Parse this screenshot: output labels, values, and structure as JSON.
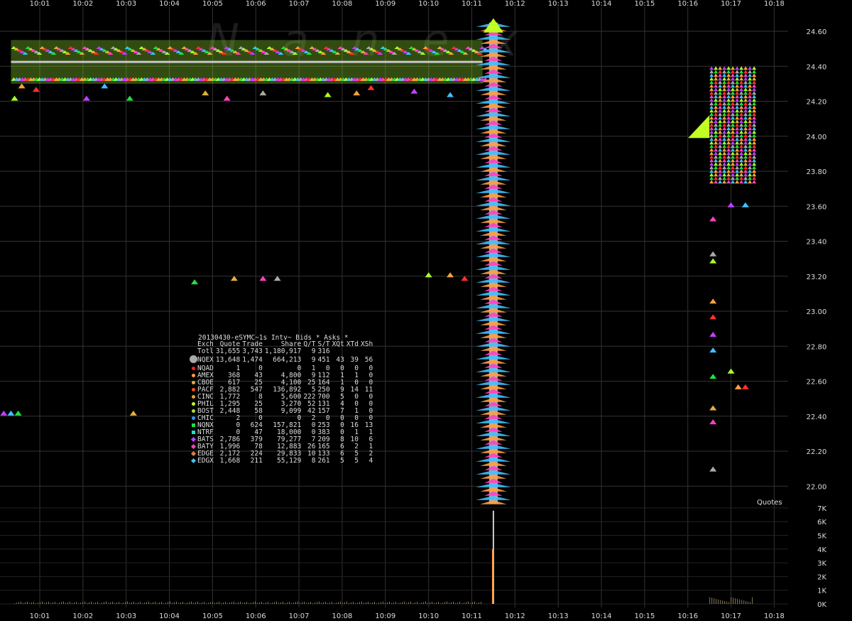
{
  "watermark": "Nanex",
  "legend": {
    "title": "20130430-eSYMC~1s Intv~ Bids * Asks *",
    "columns": [
      "Exch",
      "Quote",
      "Trade",
      "Share",
      "Q/T",
      "S/T",
      "XQt",
      "XTd",
      "XSh"
    ],
    "rows": [
      {
        "exch": "Totl",
        "quote": "31,655",
        "trade": "3,743",
        "share": "1,180,917",
        "qt": "9",
        "st": "316",
        "xqt": "",
        "xtd": "",
        "xsh": "",
        "color": "",
        "shape": "none"
      },
      {
        "exch": "NQEX",
        "quote": "13,648",
        "trade": "1,474",
        "share": "664,213",
        "qt": "9",
        "st": "451",
        "xqt": "43",
        "xtd": "39",
        "xsh": "56",
        "color": "#aaaaaa",
        "shape": "big"
      },
      {
        "exch": "NQAD",
        "quote": "1",
        "trade": "0",
        "share": "0",
        "qt": "1",
        "st": "0",
        "xqt": "0",
        "xtd": "0",
        "xsh": "0",
        "color": "#ff2020",
        "shape": "dot"
      },
      {
        "exch": "AMEX",
        "quote": "368",
        "trade": "43",
        "share": "4,800",
        "qt": "9",
        "st": "112",
        "xqt": "1",
        "xtd": "1",
        "xsh": "0",
        "color": "#ff9f40",
        "shape": "dot"
      },
      {
        "exch": "CBOE",
        "quote": "617",
        "trade": "25",
        "share": "4,100",
        "qt": "25",
        "st": "164",
        "xqt": "1",
        "xtd": "0",
        "xsh": "0",
        "color": "#e0b040",
        "shape": "dot"
      },
      {
        "exch": "PACF",
        "quote": "2,882",
        "trade": "547",
        "share": "136,892",
        "qt": "5",
        "st": "250",
        "xqt": "9",
        "xtd": "14",
        "xsh": "11",
        "color": "#ff5010",
        "shape": "dot"
      },
      {
        "exch": "CINC",
        "quote": "1,772",
        "trade": "8",
        "share": "5,600",
        "qt": "222",
        "st": "700",
        "xqt": "5",
        "xtd": "0",
        "xsh": "0",
        "color": "#f0a020",
        "shape": "dot"
      },
      {
        "exch": "PHIL",
        "quote": "1,295",
        "trade": "25",
        "share": "3,270",
        "qt": "52",
        "st": "131",
        "xqt": "4",
        "xtd": "0",
        "xsh": "0",
        "color": "#c0ff20",
        "shape": "dot"
      },
      {
        "exch": "BOST",
        "quote": "2,448",
        "trade": "58",
        "share": "9,099",
        "qt": "42",
        "st": "157",
        "xqt": "7",
        "xtd": "1",
        "xsh": "0",
        "color": "#a8e040",
        "shape": "dot"
      },
      {
        "exch": "CHIC",
        "quote": "2",
        "trade": "0",
        "share": "0",
        "qt": "2",
        "st": "0",
        "xqt": "0",
        "xtd": "0",
        "xsh": "0",
        "color": "#4090ff",
        "shape": "dot"
      },
      {
        "exch": "NQNX",
        "quote": "0",
        "trade": "624",
        "share": "157,821",
        "qt": "0",
        "st": "253",
        "xqt": "0",
        "xtd": "16",
        "xsh": "13",
        "color": "#20e040",
        "shape": "sq"
      },
      {
        "exch": "NTRF",
        "quote": "0",
        "trade": "47",
        "share": "18,000",
        "qt": "0",
        "st": "383",
        "xqt": "0",
        "xtd": "1",
        "xsh": "1",
        "color": "#20e0c0",
        "shape": "sq"
      },
      {
        "exch": "BATS",
        "quote": "2,786",
        "trade": "379",
        "share": "79,277",
        "qt": "7",
        "st": "209",
        "xqt": "8",
        "xtd": "10",
        "xsh": "6",
        "color": "#c040ff",
        "shape": "dia"
      },
      {
        "exch": "BATY",
        "quote": "1,996",
        "trade": "78",
        "share": "12,883",
        "qt": "26",
        "st": "165",
        "xqt": "6",
        "xtd": "2",
        "xsh": "1",
        "color": "#ff40c0",
        "shape": "dia"
      },
      {
        "exch": "EDGE",
        "quote": "2,172",
        "trade": "224",
        "share": "29,833",
        "qt": "10",
        "st": "133",
        "xqt": "6",
        "xtd": "5",
        "xsh": "2",
        "color": "#e08040",
        "shape": "dia"
      },
      {
        "exch": "EDGX",
        "quote": "1,668",
        "trade": "211",
        "share": "55,129",
        "qt": "8",
        "st": "261",
        "xqt": "5",
        "xtd": "5",
        "xsh": "4",
        "color": "#40c0ff",
        "shape": "dia"
      }
    ]
  },
  "chart_data": [
    {
      "type": "scatter",
      "name_hint": "quotes",
      "x_ticks": [
        "10:01",
        "10:02",
        "10:03",
        "10:04",
        "10:05",
        "10:06",
        "10:07",
        "10:08",
        "10:09",
        "10:10",
        "10:11",
        "10:12",
        "10:13",
        "10:14",
        "10:15",
        "10:16",
        "10:17",
        "10:18"
      ],
      "y_ticks": [
        "24.60",
        "24.40",
        "24.20",
        "24.00",
        "23.80",
        "23.60",
        "23.40",
        "23.20",
        "23.00",
        "22.80",
        "22.60",
        "22.40",
        "22.20",
        "22.00"
      ],
      "ylim": [
        21.95,
        24.65
      ],
      "grid": true,
      "band": {
        "from": "10:00:20",
        "to": "10:11:15",
        "low": 24.3,
        "high": 24.55
      },
      "spike": {
        "time": "10:11:30",
        "low": 21.9,
        "high": 24.65
      },
      "after_halt_cluster": {
        "from": "10:16:30",
        "to": "10:17:30",
        "low": 23.75,
        "high": 24.4
      },
      "scattered_points": [
        {
          "t": "10:00:25",
          "p": 24.22
        },
        {
          "t": "10:00:35",
          "p": 24.29
        },
        {
          "t": "10:00:55",
          "p": 24.27
        },
        {
          "t": "10:02:05",
          "p": 24.22
        },
        {
          "t": "10:02:30",
          "p": 24.29
        },
        {
          "t": "10:03:05",
          "p": 24.22
        },
        {
          "t": "10:04:50",
          "p": 24.25
        },
        {
          "t": "10:05:20",
          "p": 24.22
        },
        {
          "t": "10:06:10",
          "p": 24.25
        },
        {
          "t": "10:07:40",
          "p": 24.24
        },
        {
          "t": "10:08:20",
          "p": 24.25
        },
        {
          "t": "10:08:40",
          "p": 24.28
        },
        {
          "t": "10:09:40",
          "p": 24.26
        },
        {
          "t": "10:10:30",
          "p": 24.24
        },
        {
          "t": "10:04:35",
          "p": 23.17
        },
        {
          "t": "10:05:30",
          "p": 23.19
        },
        {
          "t": "10:06:10",
          "p": 23.19
        },
        {
          "t": "10:06:30",
          "p": 23.19
        },
        {
          "t": "10:10:00",
          "p": 23.21
        },
        {
          "t": "10:10:30",
          "p": 23.21
        },
        {
          "t": "10:10:50",
          "p": 23.19
        },
        {
          "t": "10:00:10",
          "p": 22.42
        },
        {
          "t": "10:00:20",
          "p": 22.42
        },
        {
          "t": "10:00:30",
          "p": 22.42
        },
        {
          "t": "10:03:10",
          "p": 22.42
        },
        {
          "t": "10:16:35",
          "p": 23.53
        },
        {
          "t": "10:16:35",
          "p": 23.33
        },
        {
          "t": "10:16:35",
          "p": 23.29
        },
        {
          "t": "10:16:35",
          "p": 23.06
        },
        {
          "t": "10:16:35",
          "p": 22.97
        },
        {
          "t": "10:16:35",
          "p": 22.87
        },
        {
          "t": "10:16:35",
          "p": 22.78
        },
        {
          "t": "10:16:35",
          "p": 22.63
        },
        {
          "t": "10:16:35",
          "p": 22.45
        },
        {
          "t": "10:16:35",
          "p": 22.37
        },
        {
          "t": "10:16:35",
          "p": 22.1
        },
        {
          "t": "10:17:00",
          "p": 22.66
        },
        {
          "t": "10:17:10",
          "p": 22.57
        },
        {
          "t": "10:17:20",
          "p": 22.57
        },
        {
          "t": "10:17:00",
          "p": 23.61
        },
        {
          "t": "10:17:20",
          "p": 23.61
        }
      ]
    },
    {
      "type": "bar",
      "name_hint": "volume",
      "label": "Quotes",
      "y_ticks": [
        "7K",
        "6K",
        "5K",
        "4K",
        "3K",
        "2K",
        "1K",
        "0K"
      ],
      "ylim": [
        0,
        7000
      ],
      "spike": {
        "time": "10:11:30",
        "value": 6800
      },
      "after_halt": {
        "from": "10:16:30",
        "to": "10:17:30",
        "value": 400
      },
      "baseline_value": 150
    }
  ]
}
